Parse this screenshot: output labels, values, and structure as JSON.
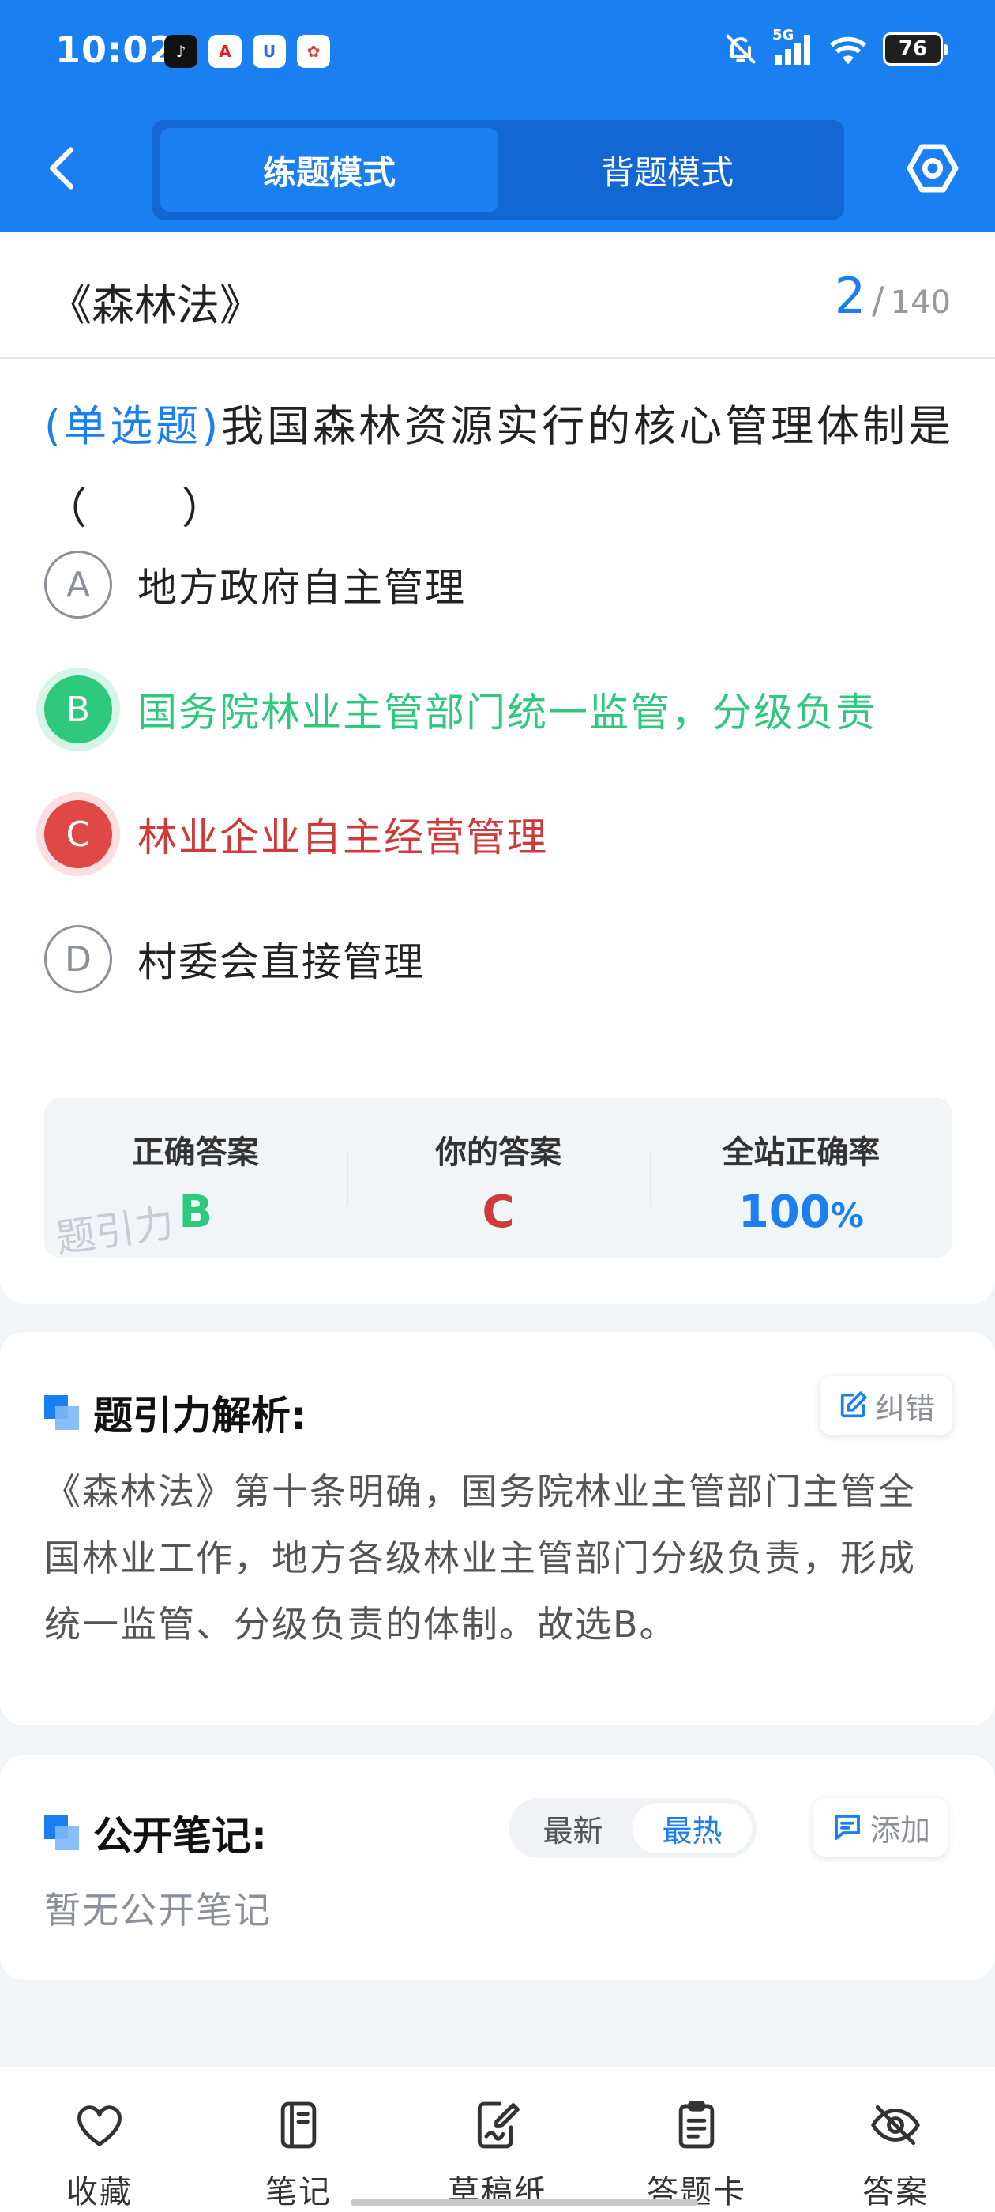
{
  "status_bar": {
    "time": "10:02",
    "battery": "76",
    "network": "5G",
    "apps": [
      {
        "name": "tiktok-icon",
        "glyph": "♪",
        "color": "#111111"
      },
      {
        "name": "app-a-icon",
        "glyph": "A",
        "color": "#ffffff"
      },
      {
        "name": "app-u-icon",
        "glyph": "U",
        "color": "#ffffff"
      },
      {
        "name": "app-logo-icon",
        "glyph": "✿",
        "color": "#ffffff"
      }
    ]
  },
  "header": {
    "tabs": [
      {
        "label": "练题模式",
        "active": true
      },
      {
        "label": "背题模式",
        "active": false
      }
    ]
  },
  "question": {
    "law_title": "《森林法》",
    "current": "2",
    "separator": "/",
    "total": "140",
    "type": "(单选题)",
    "text": "我国森林资源实行的核心管理体制是（　　）",
    "options": [
      {
        "letter": "A",
        "text": "地方政府自主管理",
        "state": "normal"
      },
      {
        "letter": "B",
        "text": "国务院林业主管部门统一监管，分级负责",
        "state": "correct"
      },
      {
        "letter": "C",
        "text": "林业企业自主经营管理",
        "state": "wrong"
      },
      {
        "letter": "D",
        "text": "村委会直接管理",
        "state": "normal"
      }
    ]
  },
  "answer_summary": {
    "correct_label": "正确答案",
    "correct_value": "B",
    "yours_label": "你的答案",
    "yours_value": "C",
    "rate_label": "全站正确率",
    "rate_value": "100",
    "rate_unit": "%",
    "watermark": "题引力"
  },
  "analysis": {
    "title": "题引力解析:",
    "correction_button": "纠错",
    "text": "《森林法》第十条明确，国务院林业主管部门主管全国林业工作，地方各级林业主管部门分级负责，形成统一监管、分级负责的体制。故选B。"
  },
  "notes": {
    "title": "公开笔记:",
    "sort_options": [
      {
        "label": "最新",
        "active": false
      },
      {
        "label": "最热",
        "active": true
      }
    ],
    "add_button": "添加",
    "empty_text": "暂无公开笔记"
  },
  "bottom_nav": [
    {
      "label": "收藏",
      "icon": "heart-icon"
    },
    {
      "label": "笔记",
      "icon": "notebook-icon"
    },
    {
      "label": "草稿纸",
      "icon": "draft-icon"
    },
    {
      "label": "答题卡",
      "icon": "answer-sheet-icon"
    },
    {
      "label": "答案",
      "icon": "eye-off-icon"
    }
  ],
  "colors": {
    "brand": "#1a7ff0",
    "correct": "#2fc97e",
    "wrong": "#e04848"
  }
}
